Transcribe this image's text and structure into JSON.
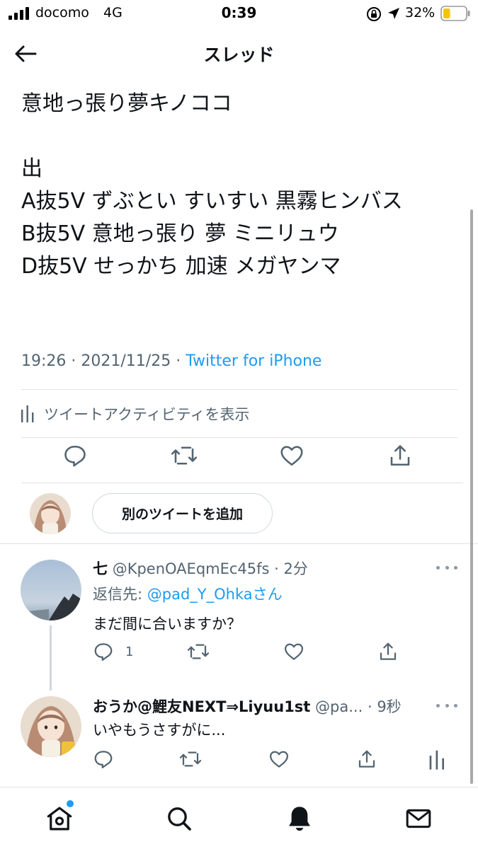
{
  "status_bar": {
    "carrier": "docomo",
    "network": "4G",
    "time": "0:39",
    "battery": "32%",
    "battery_level": 0.32
  },
  "header": {
    "title": "スレッド"
  },
  "tweet": {
    "text": "意地っ張り夢キノココ\n\n出\nA抜5V ずぶとい すいすい 黒霧ヒンバス\nB抜5V 意地っ張り 夢 ミニリュウ\nD抜5V せっかち 加速 メガヤンマ",
    "time": "19:26",
    "separator": "·",
    "date": "2021/11/25",
    "source": "Twitter for iPhone",
    "activity_label": "ツイートアクティビティを表示"
  },
  "add_tweet_label": "別のツイートを追加",
  "replies": [
    {
      "name": "七",
      "handle": "@KpenOAEqmEc45fs",
      "time": "· 2分",
      "reply_to_prefix": "返信先: ",
      "reply_to_user": "@pad_Y_Ohka",
      "reply_to_suffix": "さん",
      "text": "まだ間に合いますか？",
      "reply_count": "1"
    },
    {
      "name": "おうか@鯉友NEXT⇒Liyuu1st",
      "handle": "@pa...",
      "time": "· 9秒",
      "text": "いやもうさすがに..."
    }
  ],
  "icons": {
    "back": "back-arrow-icon",
    "reply": "reply-icon",
    "retweet": "retweet-icon",
    "like": "heart-icon",
    "share": "share-icon",
    "analytics": "analytics-icon",
    "more": "more-icon",
    "home": "home-icon",
    "search": "search-icon",
    "notifications": "bell-icon",
    "messages": "mail-icon"
  },
  "colors": {
    "accent": "#1d9bf0",
    "secondary_text": "#536471",
    "divider": "#dfe3e6"
  }
}
